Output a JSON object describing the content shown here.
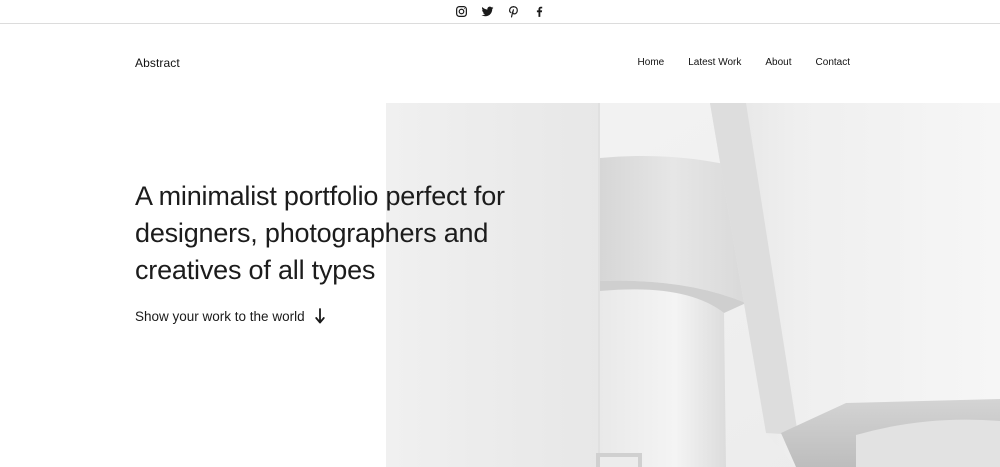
{
  "social": {
    "icons": [
      "instagram-icon",
      "twitter-icon",
      "pinterest-icon",
      "facebook-icon"
    ]
  },
  "header": {
    "site_title": "Abstract",
    "nav": [
      "Home",
      "Latest Work",
      "About",
      "Contact"
    ]
  },
  "hero": {
    "headline": "A minimalist portfolio perfect for designers, photographers and creatives of all types",
    "cta_label": "Show your work to the world",
    "cta_icon": "arrow-down-icon"
  },
  "colors": {
    "text": "#1c1c1c",
    "background": "#ffffff",
    "divider": "#dcdcdc"
  }
}
